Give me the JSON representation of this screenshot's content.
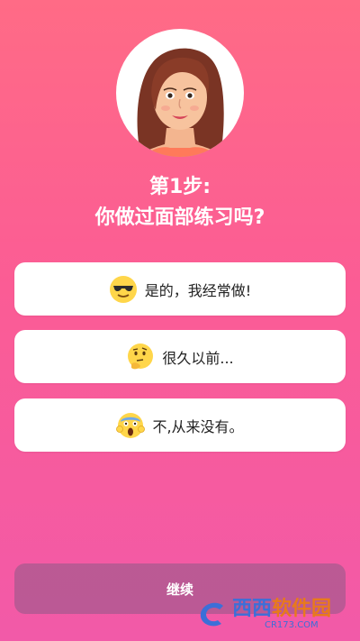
{
  "header": {
    "step_label": "第1步:",
    "question": "你做过面部练习吗?"
  },
  "options": [
    {
      "label": "是的，我经常做!",
      "icon": "sunglasses-emoji-icon"
    },
    {
      "label": "很久以前...",
      "icon": "thinking-emoji-icon"
    },
    {
      "label": "不,从来没有。",
      "icon": "screaming-emoji-icon"
    }
  ],
  "footer": {
    "continue_label": "继续"
  },
  "watermark": {
    "brand_prefix": "西西",
    "brand_suffix": "软件园",
    "url": "CR173.COM"
  },
  "colors": {
    "background_top": "#ff6b86",
    "background_bottom": "#f25aa8",
    "card": "#ffffff",
    "button_disabled": "#8c5a87"
  }
}
